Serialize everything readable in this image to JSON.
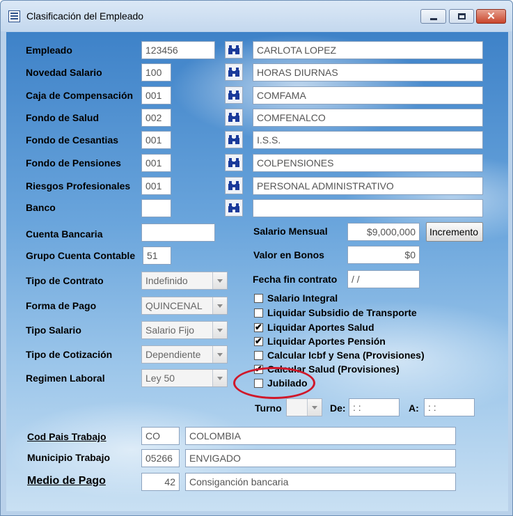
{
  "window": {
    "title": "Clasificación del Empleado",
    "minimize_label": "",
    "maximize_label": "",
    "close_label": "✕"
  },
  "form": {
    "empleado": {
      "label": "Empleado",
      "code": "123456",
      "name": "CARLOTA LOPEZ"
    },
    "novedad_salario": {
      "label": "Novedad Salario",
      "code": "100",
      "name": "HORAS DIURNAS"
    },
    "caja_compensacion": {
      "label": "Caja de Compensación",
      "code": "001",
      "name": "COMFAMA"
    },
    "fondo_salud": {
      "label": "Fondo de Salud",
      "code": "002",
      "name": "COMFENALCO"
    },
    "fondo_cesantias": {
      "label": "Fondo de Cesantias",
      "code": "001",
      "name": "I.S.S."
    },
    "fondo_pensiones": {
      "label": "Fondo de Pensiones",
      "code": "001",
      "name": "COLPENSIONES"
    },
    "riesgos_profesionales": {
      "label": "Riesgos Profesionales",
      "code": "001",
      "name": "PERSONAL ADMINISTRATIVO"
    },
    "banco": {
      "label": "Banco",
      "code": "",
      "name": ""
    },
    "cuenta_bancaria": {
      "label": "Cuenta Bancaria",
      "value": ""
    },
    "grupo_cuenta_contable": {
      "label": "Grupo Cuenta Contable",
      "value": "51"
    },
    "tipo_contrato": {
      "label": "Tipo de Contrato",
      "value": "Indefinido"
    },
    "forma_pago": {
      "label": "Forma de Pago",
      "value": "QUINCENAL"
    },
    "tipo_salario": {
      "label": "Tipo Salario",
      "value": "Salario Fijo"
    },
    "tipo_cotizacion": {
      "label": "Tipo de Cotización",
      "value": "Dependiente"
    },
    "regimen_laboral": {
      "label": "Regimen Laboral",
      "value": "Ley 50"
    },
    "salario_mensual": {
      "label": "Salario Mensual",
      "value": "$9,000,000",
      "button": "Incremento"
    },
    "valor_bonos": {
      "label": "Valor en Bonos",
      "value": "$0"
    },
    "fecha_fin_contrato": {
      "label": "Fecha fin contrato",
      "value": " / /"
    },
    "checkboxes": [
      {
        "label": "Salario Integral",
        "checked": false
      },
      {
        "label": "Liquidar Subsidio de Transporte",
        "checked": false
      },
      {
        "label": "Liquidar Aportes Salud",
        "checked": true
      },
      {
        "label": "Liquidar Aportes Pensión",
        "checked": true
      },
      {
        "label": "Calcular Icbf y Sena (Provisiones)",
        "checked": false
      },
      {
        "label": "Calcular Salud (Provisiones)",
        "checked": true
      },
      {
        "label": "Jubilado",
        "checked": false
      }
    ],
    "turno": {
      "label": "Turno",
      "value": "",
      "de_label": "De:",
      "de_value": " : :",
      "a_label": "A:",
      "a_value": " : :"
    },
    "cod_pais_trabajo": {
      "label": "Cod Pais Trabajo",
      "code": "CO",
      "name": "COLOMBIA"
    },
    "municipio_trabajo": {
      "label": "Municipio Trabajo",
      "code": "05266",
      "name": "ENVIGADO"
    },
    "medio_pago": {
      "label": "Medio de Pago",
      "code": "42",
      "name": "Consiganción bancaria"
    }
  },
  "colors": {
    "highlight": "#d0182a",
    "sky": "#6aa5dc"
  },
  "icons": {
    "lookup": "binoculars-icon",
    "app": "table-icon"
  }
}
